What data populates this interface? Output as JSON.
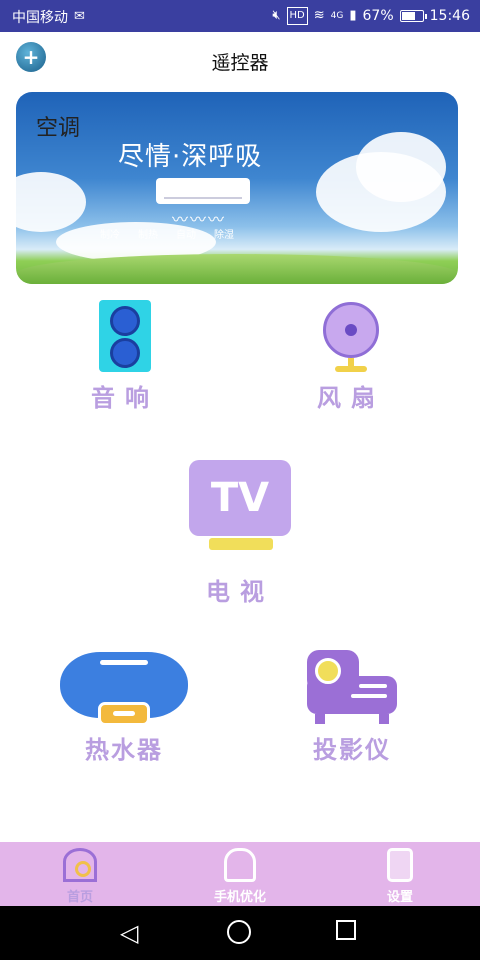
{
  "status_bar": {
    "carrier": "中国移动",
    "wechat_icon": "wechat-icon",
    "mute_icon": "mute-icon",
    "hd": "HD",
    "network": "4G",
    "battery_percent": "67%",
    "battery_level": 0.67,
    "time": "15:46"
  },
  "header": {
    "title": "遥控器",
    "logo_icon": "plus-icon"
  },
  "banner": {
    "label": "空调",
    "slogan": "尽情·深呼吸",
    "modes": [
      "制冷",
      "制热",
      "自动",
      "除湿"
    ]
  },
  "devices": {
    "speaker": "音响",
    "fan": "风扇",
    "tv": "电视",
    "tv_screen": "TV",
    "heater": "热水器",
    "projector": "投影仪"
  },
  "bottom_nav": {
    "home": "首页",
    "optimize": "手机优化",
    "settings": "设置"
  }
}
